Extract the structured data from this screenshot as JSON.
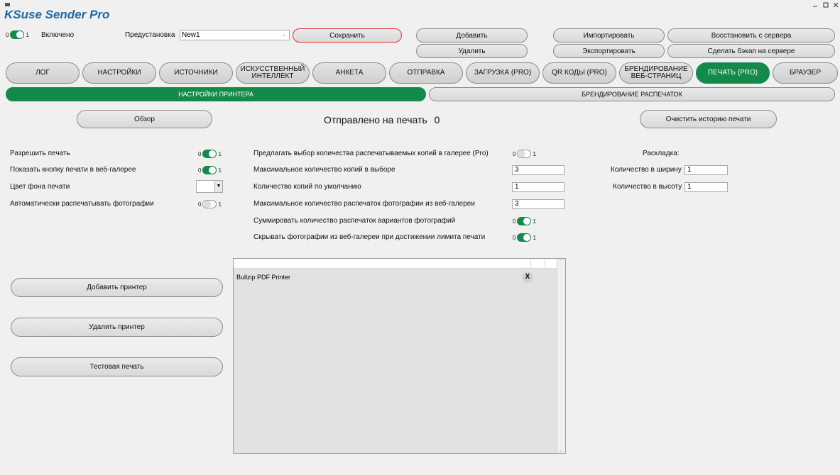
{
  "titlebar": {
    "title": "KSuse Sender Pro"
  },
  "top": {
    "enable_toggle": {
      "off": "0",
      "on": "1",
      "label": "Включено",
      "state": "on"
    },
    "preset_label": "Предустановка",
    "preset_value": "New1",
    "save": "Сохранить",
    "add": "Добавить",
    "delete": "Удалить",
    "import": "Импортировать",
    "export": "Экспортировать",
    "restore": "Восстановить с сервера",
    "backup": "Сделать бэкап на сервере"
  },
  "tabs": [
    {
      "label": "ЛОГ"
    },
    {
      "label": "НАСТРОЙКИ"
    },
    {
      "label": "ИСТОЧНИКИ"
    },
    {
      "label": "ИСКУССТВЕННЫЙ ИНТЕЛЛЕКТ"
    },
    {
      "label": "АНКЕТА"
    },
    {
      "label": "ОТПРАВКА"
    },
    {
      "label": "ЗАГРУЗКА (PRO)"
    },
    {
      "label": "QR КОДЫ (PRO)"
    },
    {
      "label": "БРЕНДИРОВАНИЕ ВЕБ-СТРАНИЦ"
    },
    {
      "label": "ПЕЧАТЬ (PRO)",
      "active": true
    },
    {
      "label": "БРАУЗЕР"
    }
  ],
  "subtabs": {
    "printer_settings": "НАСТРОЙКИ ПРИНТЕРА",
    "print_branding": "БРЕНДИРОВАНИЕ РАСПЕЧАТОК"
  },
  "actions": {
    "browse": "Обзор",
    "sent_label": "Отправлено на печать",
    "sent_count": "0",
    "clear_history": "Очистить историю печати"
  },
  "left_settings": {
    "allow_print": "Разрешить печать",
    "show_print_button": "Показать кнопку печати в веб-галерее",
    "bg_color": "Цвет фона печати",
    "auto_print": "Автоматически распечатывать фотографии",
    "toggle_off": "0",
    "toggle_on": "1"
  },
  "mid_settings": {
    "offer_copies": "Предлагать выбор количества распечатываемых копий в галерее (Pro)",
    "max_copies": "Максимальное количество копий в выборе",
    "max_copies_value": "3",
    "default_copies": "Количество копий по умолчанию",
    "default_copies_value": "1",
    "max_prints": "Максимальное количество распечаток фотографии из веб-галереи",
    "max_prints_value": "3",
    "sum_variants": "Суммировать количество распечаток вариантов фотографий",
    "hide_photos": "Скрывать фотографии из веб-галереи при достижении лимита печати"
  },
  "layout_settings": {
    "title": "Раскладка:",
    "width_label": "Количество в ширину",
    "width_value": "1",
    "height_label": "Количество в высоту",
    "height_value": "1"
  },
  "printer_buttons": {
    "add": "Добавить принтер",
    "remove": "Удалить принтер",
    "test": "Тестовая печать"
  },
  "printers": {
    "items": [
      "Bullzip PDF Printer"
    ],
    "remove_symbol": "X"
  },
  "colors": {
    "accent": "#138a4a",
    "title": "#1a6aa8"
  }
}
